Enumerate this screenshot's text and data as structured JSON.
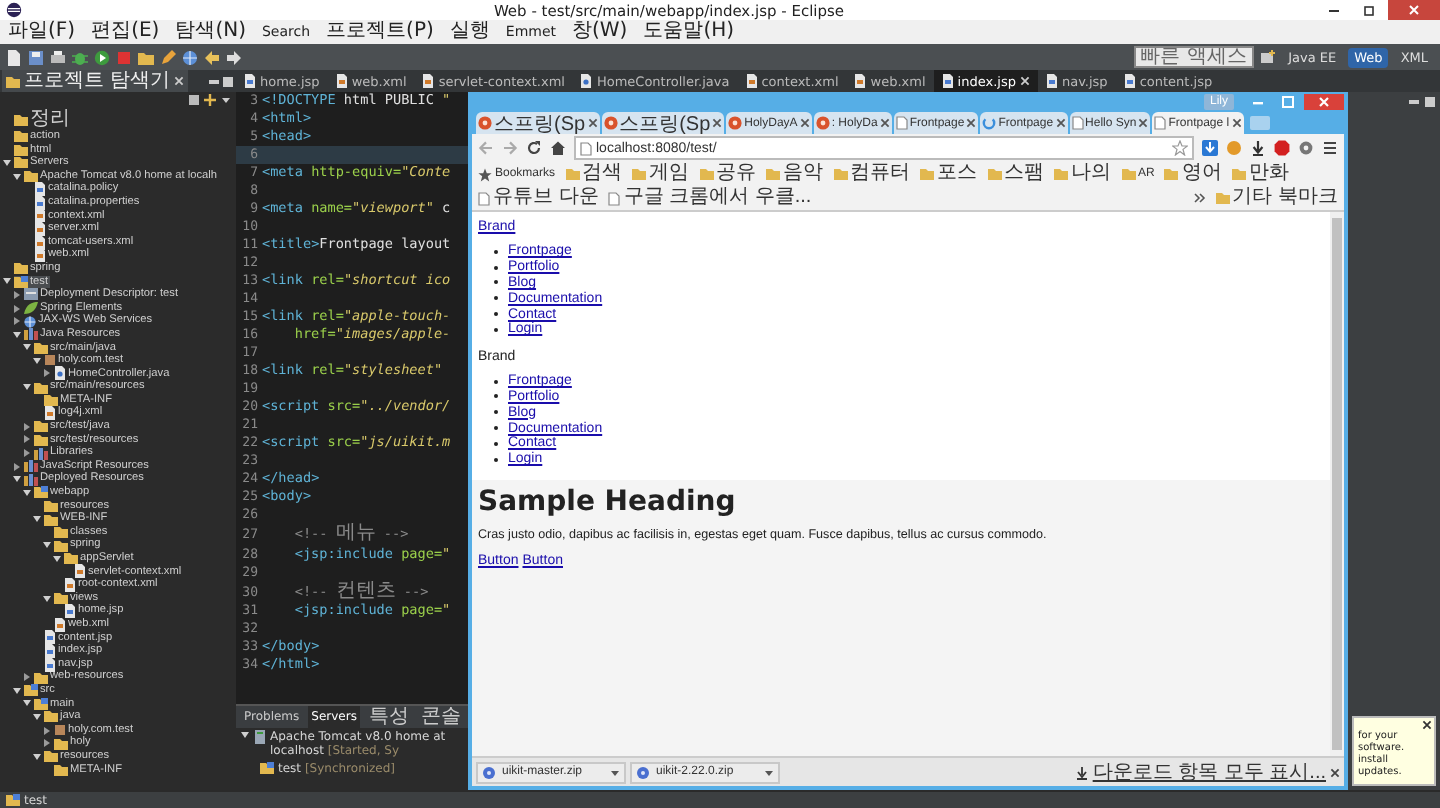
{
  "window": {
    "title": "Web - test/src/main/webapp/index.jsp - Eclipse"
  },
  "menu": [
    "파일(F)",
    "편집(E)",
    "탐색(N)",
    "Search",
    "프로젝트(P)",
    "실행",
    "Emmet",
    "창(W)",
    "도움말(H)"
  ],
  "quick_access": {
    "placeholder": "빠른 액세스"
  },
  "perspectives": [
    {
      "label": "Java EE",
      "selected": false
    },
    {
      "label": "Web",
      "selected": true
    },
    {
      "label": "XML",
      "selected": false
    }
  ],
  "explorer": {
    "title": "프로젝트 탐색기",
    "items": [
      {
        "label": "정리",
        "kind": "folder",
        "selected": false
      },
      {
        "label": "action",
        "kind": "folder",
        "selected": false
      },
      {
        "label": "html",
        "kind": "folder",
        "selected": false
      },
      {
        "label": "Servers",
        "kind": "folder",
        "selected": false,
        "expanded": true,
        "children": [
          {
            "label": "Apache Tomcat v8.0 home at localh",
            "kind": "folder",
            "selected": false,
            "expanded": true,
            "children": [
              {
                "label": "catalina.policy",
                "kind": "file",
                "selected": false
              },
              {
                "label": "catalina.properties",
                "kind": "file",
                "selected": false
              },
              {
                "label": "context.xml",
                "kind": "xml",
                "selected": false
              },
              {
                "label": "server.xml",
                "kind": "xml",
                "selected": false
              },
              {
                "label": "tomcat-users.xml",
                "kind": "xml",
                "selected": false
              },
              {
                "label": "web.xml",
                "kind": "xml",
                "selected": false
              }
            ]
          }
        ]
      },
      {
        "label": "spring",
        "kind": "folder",
        "selected": false
      },
      {
        "label": "test",
        "kind": "project",
        "selected": true,
        "expanded": true,
        "children": [
          {
            "label": "Deployment Descriptor: test",
            "kind": "descriptor",
            "selected": false,
            "expanded": false
          },
          {
            "label": "Spring Elements",
            "kind": "spring",
            "selected": false,
            "expanded": false
          },
          {
            "label": "JAX-WS Web Services",
            "kind": "service",
            "selected": false,
            "expanded": false
          },
          {
            "label": "Java Resources",
            "kind": "library",
            "selected": false,
            "expanded": true,
            "children": [
              {
                "label": "src/main/java",
                "kind": "folder",
                "selected": false,
                "expanded": true,
                "children": [
                  {
                    "label": "holy.com.test",
                    "kind": "package",
                    "selected": false,
                    "expanded": true,
                    "children": [
                      {
                        "label": "HomeController.java",
                        "kind": "java",
                        "selected": false,
                        "expanded": false
                      }
                    ]
                  }
                ]
              },
              {
                "label": "src/main/resources",
                "kind": "folder",
                "selected": false,
                "expanded": true,
                "children": [
                  {
                    "label": "META-INF",
                    "kind": "folder",
                    "selected": false
                  },
                  {
                    "label": "log4j.xml",
                    "kind": "xml",
                    "selected": false
                  }
                ]
              },
              {
                "label": "src/test/java",
                "kind": "folder",
                "selected": false,
                "expanded": false
              },
              {
                "label": "src/test/resources",
                "kind": "folder",
                "selected": false,
                "expanded": false
              },
              {
                "label": "Libraries",
                "kind": "library",
                "selected": false,
                "expanded": false
              }
            ]
          },
          {
            "label": "JavaScript Resources",
            "kind": "library",
            "selected": false,
            "expanded": false
          },
          {
            "label": "Deployed Resources",
            "kind": "library",
            "selected": false,
            "expanded": true,
            "children": [
              {
                "label": "webapp",
                "kind": "project",
                "selected": false,
                "expanded": true,
                "children": [
                  {
                    "label": "resources",
                    "kind": "folder",
                    "selected": false
                  },
                  {
                    "label": "WEB-INF",
                    "kind": "folder",
                    "selected": false,
                    "expanded": true,
                    "children": [
                      {
                        "label": "classes",
                        "kind": "folder",
                        "selected": false
                      },
                      {
                        "label": "spring",
                        "kind": "folder",
                        "selected": false,
                        "expanded": true,
                        "children": [
                          {
                            "label": "appServlet",
                            "kind": "folder",
                            "selected": false,
                            "expanded": true,
                            "children": [
                              {
                                "label": "servlet-context.xml",
                                "kind": "xml",
                                "selected": false
                              }
                            ]
                          },
                          {
                            "label": "root-context.xml",
                            "kind": "xml",
                            "selected": false
                          }
                        ]
                      },
                      {
                        "label": "views",
                        "kind": "folder",
                        "selected": false,
                        "expanded": true,
                        "children": [
                          {
                            "label": "home.jsp",
                            "kind": "file",
                            "selected": false
                          }
                        ]
                      },
                      {
                        "label": "web.xml",
                        "kind": "xml",
                        "selected": false
                      }
                    ]
                  },
                  {
                    "label": "content.jsp",
                    "kind": "file",
                    "selected": false
                  },
                  {
                    "label": "index.jsp",
                    "kind": "file",
                    "selected": false
                  },
                  {
                    "label": "nav.jsp",
                    "kind": "file",
                    "selected": false
                  }
                ]
              },
              {
                "label": "web-resources",
                "kind": "folder",
                "selected": false,
                "expanded": false
              }
            ]
          },
          {
            "label": "src",
            "kind": "project",
            "selected": false,
            "expanded": true,
            "children": [
              {
                "label": "main",
                "kind": "project",
                "selected": false,
                "expanded": true,
                "children": [
                  {
                    "label": "java",
                    "kind": "folder",
                    "selected": false,
                    "expanded": true,
                    "children": [
                      {
                        "label": "holy.com.test",
                        "kind": "package",
                        "selected": false,
                        "expanded": false
                      },
                      {
                        "label": "holy",
                        "kind": "folder",
                        "selected": false,
                        "expanded": false
                      }
                    ]
                  },
                  {
                    "label": "resources",
                    "kind": "folder",
                    "selected": false,
                    "expanded": true,
                    "children": [
                      {
                        "label": "META-INF",
                        "kind": "folder",
                        "selected": false
                      }
                    ]
                  }
                ]
              }
            ]
          }
        ]
      }
    ]
  },
  "editor_tabs": [
    {
      "label": "home.jsp",
      "kind": "jsp",
      "selected": false
    },
    {
      "label": "web.xml",
      "kind": "xml",
      "selected": false
    },
    {
      "label": "servlet-context.xml",
      "kind": "xml",
      "selected": false
    },
    {
      "label": "HomeController.java",
      "kind": "java",
      "selected": false
    },
    {
      "label": "context.xml",
      "kind": "xml",
      "selected": false
    },
    {
      "label": "web.xml",
      "kind": "xml",
      "selected": false
    },
    {
      "label": "index.jsp",
      "kind": "jsp",
      "selected": true
    },
    {
      "label": "nav.jsp",
      "kind": "jsp",
      "selected": false
    },
    {
      "label": "content.jsp",
      "kind": "jsp",
      "selected": false
    }
  ],
  "editor": {
    "lines": [
      {
        "number": "3",
        "text": "<!DOCTYPE html PUBLIC \"",
        "current": false
      },
      {
        "number": "4",
        "text": "<html>",
        "current": false
      },
      {
        "number": "5",
        "text": "<head>",
        "current": false
      },
      {
        "number": "6",
        "current": true
      },
      {
        "number": "7",
        "text": "<meta http-equiv=\"Conte",
        "current": false
      },
      {
        "number": "8",
        "current": false
      },
      {
        "number": "9",
        "text": "<meta name=\"viewport\" c",
        "current": false
      },
      {
        "number": "10",
        "current": false
      },
      {
        "number": "11",
        "text": "<title>Frontpage layout",
        "current": false
      },
      {
        "number": "12",
        "current": false
      },
      {
        "number": "13",
        "text": "<link rel=\"shortcut ico",
        "current": false
      },
      {
        "number": "14",
        "current": false
      },
      {
        "number": "15",
        "text": "<link rel=\"apple-touch-",
        "current": false
      },
      {
        "number": "16",
        "text": "    href=\"images/apple-",
        "current": false
      },
      {
        "number": "17",
        "current": false
      },
      {
        "number": "18",
        "text": "<link rel=\"stylesheet\"",
        "current": false
      },
      {
        "number": "19",
        "current": false
      },
      {
        "number": "20",
        "text": "<script src=\"../vendor/",
        "current": false
      },
      {
        "number": "21",
        "current": false
      },
      {
        "number": "22",
        "text": "<script src=\"js/uikit.m",
        "current": false
      },
      {
        "number": "23",
        "current": false
      },
      {
        "number": "24",
        "text": "</head>",
        "current": false
      },
      {
        "number": "25",
        "text": "<body>",
        "current": false
      },
      {
        "number": "26",
        "current": false
      },
      {
        "number": "27",
        "text": "    <!-- 메뉴 -->",
        "current": false
      },
      {
        "number": "28",
        "text": "    <jsp:include page=\"",
        "current": false
      },
      {
        "number": "29",
        "current": false
      },
      {
        "number": "30",
        "text": "    <!-- 컨텐츠 -->",
        "current": false
      },
      {
        "number": "31",
        "text": "    <jsp:include page=\"",
        "current": false
      },
      {
        "number": "32",
        "current": false
      },
      {
        "number": "33",
        "text": "</body>",
        "current": false
      },
      {
        "number": "34",
        "text": "</html>",
        "current": false
      }
    ]
  },
  "servers_view": {
    "tabs": [
      {
        "label": "Problems",
        "selected": false
      },
      {
        "label": "Servers",
        "selected": true
      },
      {
        "label": "특성",
        "selected": false
      },
      {
        "label": "콘솔",
        "selected": false
      }
    ],
    "server": {
      "label": "Apache Tomcat v8.0 home at localhost",
      "status": "[Started, Sy"
    },
    "module": {
      "label": "test",
      "status": "[Synchronized]"
    }
  },
  "browser": {
    "profile": "Lily",
    "tabs": [
      {
        "title": "스프링(Sp",
        "kind": "site",
        "selected": false
      },
      {
        "title": "스프링(Sp",
        "kind": "site",
        "selected": false
      },
      {
        "title": "HolyDayA",
        "kind": "site",
        "selected": false
      },
      {
        "title": ": HolyDa",
        "kind": "site",
        "selected": false
      },
      {
        "title": "Frontpage",
        "kind": "page",
        "selected": false
      },
      {
        "title": "Frontpage",
        "kind": "loading",
        "selected": false
      },
      {
        "title": "Hello Syn",
        "kind": "page",
        "selected": false
      },
      {
        "title": "Frontpage l",
        "kind": "page",
        "selected": true
      }
    ],
    "url": "localhost:8080/test/",
    "bookmarks": [
      {
        "label": "Bookmarks",
        "kind": "star"
      },
      {
        "label": "검색",
        "kind": "folder"
      },
      {
        "label": "게임",
        "kind": "folder"
      },
      {
        "label": "공유",
        "kind": "folder"
      },
      {
        "label": "음악",
        "kind": "folder"
      },
      {
        "label": "컴퓨터",
        "kind": "folder"
      },
      {
        "label": "포스",
        "kind": "folder"
      },
      {
        "label": "스팸",
        "kind": "folder"
      },
      {
        "label": "나의",
        "kind": "folder"
      },
      {
        "label": "AR",
        "kind": "folder"
      },
      {
        "label": "영어",
        "kind": "folder"
      },
      {
        "label": "만화",
        "kind": "folder"
      },
      {
        "label": "유튜브 다운",
        "kind": "page"
      },
      {
        "label": "구글 크롬에서 우클...",
        "kind": "page"
      }
    ],
    "other_bookmarks": "기타 북마크",
    "page": {
      "brand_link": "Brand",
      "nav": [
        "Frontpage",
        "Portfolio",
        "Blog",
        "Documentation",
        "Contact",
        "Login"
      ],
      "brand": "Brand",
      "nav_2": [
        "Frontpage",
        "Portfolio",
        "Blog",
        "Documentation",
        "Contact",
        "Login"
      ],
      "heading": "Sample Heading",
      "paragraph": "Cras justo odio, dapibus ac facilisis in, egestas eget quam. Fusce dapibus, tellus ac cursus commodo.",
      "buttons": [
        "Button",
        "Button"
      ]
    },
    "downloads": [
      "uikit-master.zip",
      "uikit-2.22.0.zip"
    ],
    "show_all_downloads": "다운로드 항목 모두 표시..."
  },
  "notification": {
    "lines": [
      "for your software.",
      "install updates."
    ]
  },
  "status_bar": {
    "text": "test"
  }
}
